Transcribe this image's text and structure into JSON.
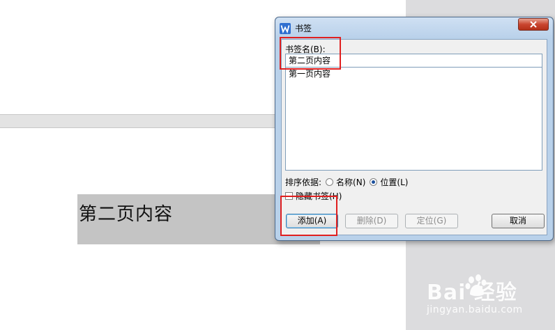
{
  "document": {
    "selected_text": "第二页内容"
  },
  "dialog": {
    "title": "书签",
    "bookmark_name_label": "书签名(B):",
    "bookmark_name_value": "第二页内容",
    "bookmarks": [
      "第一页内容"
    ],
    "sort_label": "排序依据:",
    "sort_options": [
      {
        "label": "名称(N)",
        "selected": false
      },
      {
        "label": "位置(L)",
        "selected": true
      }
    ],
    "hide_bookmarks_label": "隐藏书签(H)",
    "hide_bookmarks_checked": false,
    "buttons": {
      "add": "添加(A)",
      "delete": "删除(D)",
      "goto": "定位(G)",
      "cancel": "取消"
    }
  },
  "watermark": {
    "brand": "Bai  经验",
    "url": "jingyan.baidu.com"
  },
  "colors": {
    "highlight": "#e01f1f",
    "dialog_frame": "#b9d1ea",
    "selection": "#c4c4c4"
  }
}
